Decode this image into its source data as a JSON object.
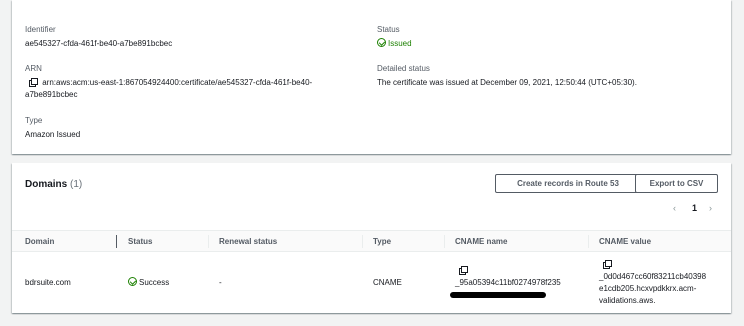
{
  "details": {
    "identifier_label": "Identifier",
    "identifier_value": "ae545327-cfda-461f-be40-a7be891bcbec",
    "arn_label": "ARN",
    "arn_line1": "arn:aws:acm:us-east-1:867054924400:certificate/ae545327-cfda-461f-be40-",
    "arn_line2": "a7be891bcbec",
    "type_label": "Type",
    "type_value": "Amazon Issued",
    "status_label": "Status",
    "status_value": "Issued",
    "detailed_status_label": "Detailed status",
    "detailed_status_value": "The certificate was issued at December 09, 2021, 12:50:44 (UTC+05:30)."
  },
  "domains": {
    "title": "Domains",
    "count": "(1)",
    "create_records_label": "Create records in Route 53",
    "export_label": "Export to CSV",
    "pager": {
      "prev": "‹",
      "page": "1",
      "next": "›"
    },
    "columns": [
      "Domain",
      "Status",
      "Renewal status",
      "Type",
      "CNAME name",
      "CNAME value"
    ],
    "rows": [
      {
        "domain": "bdrsuite.com",
        "status": "Success",
        "renewal": "-",
        "type": "CNAME",
        "cname_name": "_95a05394c11bf0274978f235",
        "cname_value_1": "_0d0d467cc60f83211cb40398",
        "cname_value_2": "e1cdb205.hcxvpdkkrx.acm-",
        "cname_value_3": "validations.aws."
      }
    ]
  },
  "colors": {
    "success": "#1d8102",
    "label": "#545b64",
    "text": "#16191f"
  }
}
